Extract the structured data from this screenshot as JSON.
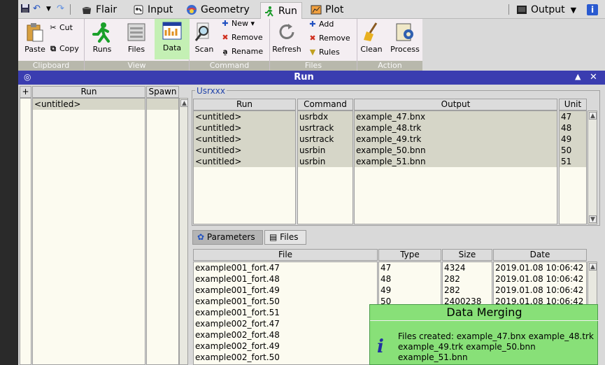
{
  "quick_access": {
    "save": "save-icon",
    "undo": "undo-icon",
    "redo": "redo-icon"
  },
  "menu_tabs": [
    {
      "label": "Flair",
      "icon": "flair-icon"
    },
    {
      "label": "Input",
      "icon": "input-icon"
    },
    {
      "label": "Geometry",
      "icon": "geometry-icon"
    },
    {
      "label": "Run",
      "icon": "run-icon",
      "active": true
    },
    {
      "label": "Plot",
      "icon": "plot-icon"
    }
  ],
  "output_menu": {
    "label": "Output"
  },
  "ribbon": {
    "clipboard": {
      "label": "Clipboard",
      "paste": "Paste",
      "cut": "Cut",
      "copy": "Copy"
    },
    "view": {
      "label": "View",
      "runs": "Runs",
      "files": "Files",
      "data": "Data"
    },
    "command": {
      "label": "Command",
      "scan": "Scan",
      "new": "New ▾",
      "remove": "Remove",
      "rename": "Rename"
    },
    "files": {
      "label": "Files",
      "refresh": "Refresh",
      "add": "Add",
      "remove": "Remove",
      "rules": "Rules"
    },
    "action": {
      "label": "Action",
      "clean": "Clean",
      "process": "Process"
    }
  },
  "panel": {
    "title": "Run",
    "minimize": "▲",
    "close": "✕",
    "pin": "◎"
  },
  "left_table": {
    "headers": {
      "plus": "+",
      "run": "Run",
      "spawn": "Spawn"
    },
    "rows": [
      "<untitled>"
    ]
  },
  "usrxxx": {
    "title": "Usrxxx",
    "headers": [
      "Run",
      "Command",
      "Output",
      "Unit"
    ],
    "rows": [
      {
        "run": "<untitled>",
        "command": "usrbdx",
        "output": "example_47.bnx",
        "unit": "47"
      },
      {
        "run": "<untitled>",
        "command": "usrtrack",
        "output": "example_48.trk",
        "unit": "48"
      },
      {
        "run": "<untitled>",
        "command": "usrtrack",
        "output": "example_49.trk",
        "unit": "49"
      },
      {
        "run": "<untitled>",
        "command": "usrbin",
        "output": "example_50.bnn",
        "unit": "50"
      },
      {
        "run": "<untitled>",
        "command": "usrbin",
        "output": "example_51.bnn",
        "unit": "51"
      }
    ]
  },
  "subtabs": {
    "parameters": "Parameters",
    "files": "Files"
  },
  "files_table": {
    "headers": [
      "File",
      "Type",
      "Size",
      "Date"
    ],
    "rows": [
      {
        "file": "example001_fort.47",
        "type": "47",
        "size": "4324",
        "date": "2019.01.08 10:06:42"
      },
      {
        "file": "example001_fort.48",
        "type": "48",
        "size": "282",
        "date": "2019.01.08 10:06:42"
      },
      {
        "file": "example001_fort.49",
        "type": "49",
        "size": "282",
        "date": "2019.01.08 10:06:42"
      },
      {
        "file": "example001_fort.50",
        "type": "50",
        "size": "2400238",
        "date": "2019.01.08 10:06:42"
      },
      {
        "file": "example001_fort.51",
        "type": "",
        "size": "",
        "date": ""
      },
      {
        "file": "example002_fort.47",
        "type": "",
        "size": "",
        "date": ""
      },
      {
        "file": "example002_fort.48",
        "type": "",
        "size": "",
        "date": ""
      },
      {
        "file": "example002_fort.49",
        "type": "",
        "size": "",
        "date": ""
      },
      {
        "file": "example002_fort.50",
        "type": "",
        "size": "",
        "date": ""
      }
    ]
  },
  "notice": {
    "title": "Data Merging",
    "lines": [
      "Files created: example_47.bnx example_48.trk",
      "example_49.trk example_50.bnn",
      "example_51.bnn"
    ]
  },
  "colors": {
    "accent": "#3a3db0",
    "ribbon": "#f4eef2",
    "notice": "#88e078",
    "selected": "#c4f0b4"
  }
}
